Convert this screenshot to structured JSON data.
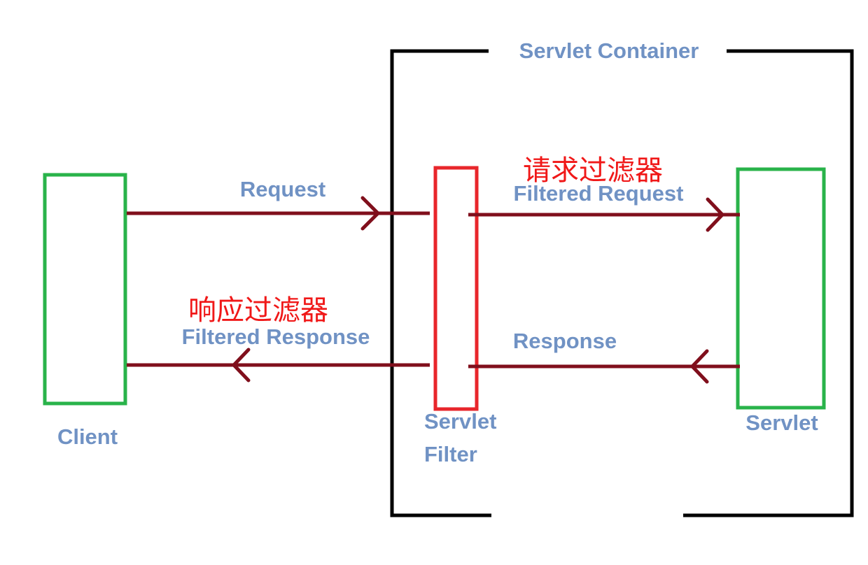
{
  "container": {
    "title": "Servlet Container"
  },
  "nodes": {
    "client": "Client",
    "filter_line1": "Servlet",
    "filter_line2": "Filter",
    "servlet": "Servlet"
  },
  "flows": {
    "request": "Request",
    "filtered_request": "Filtered Request",
    "request_filter_cn": "请求过滤器",
    "response": "Response",
    "filtered_response": "Filtered Response",
    "response_filter_cn": "响应过滤器"
  },
  "colors": {
    "label_blue": "#7092c4",
    "annotation_red": "#f01818",
    "arrow": "#800f1c",
    "box_green": "#29b34a",
    "box_red": "#e8262b",
    "container_border": "#000000"
  }
}
